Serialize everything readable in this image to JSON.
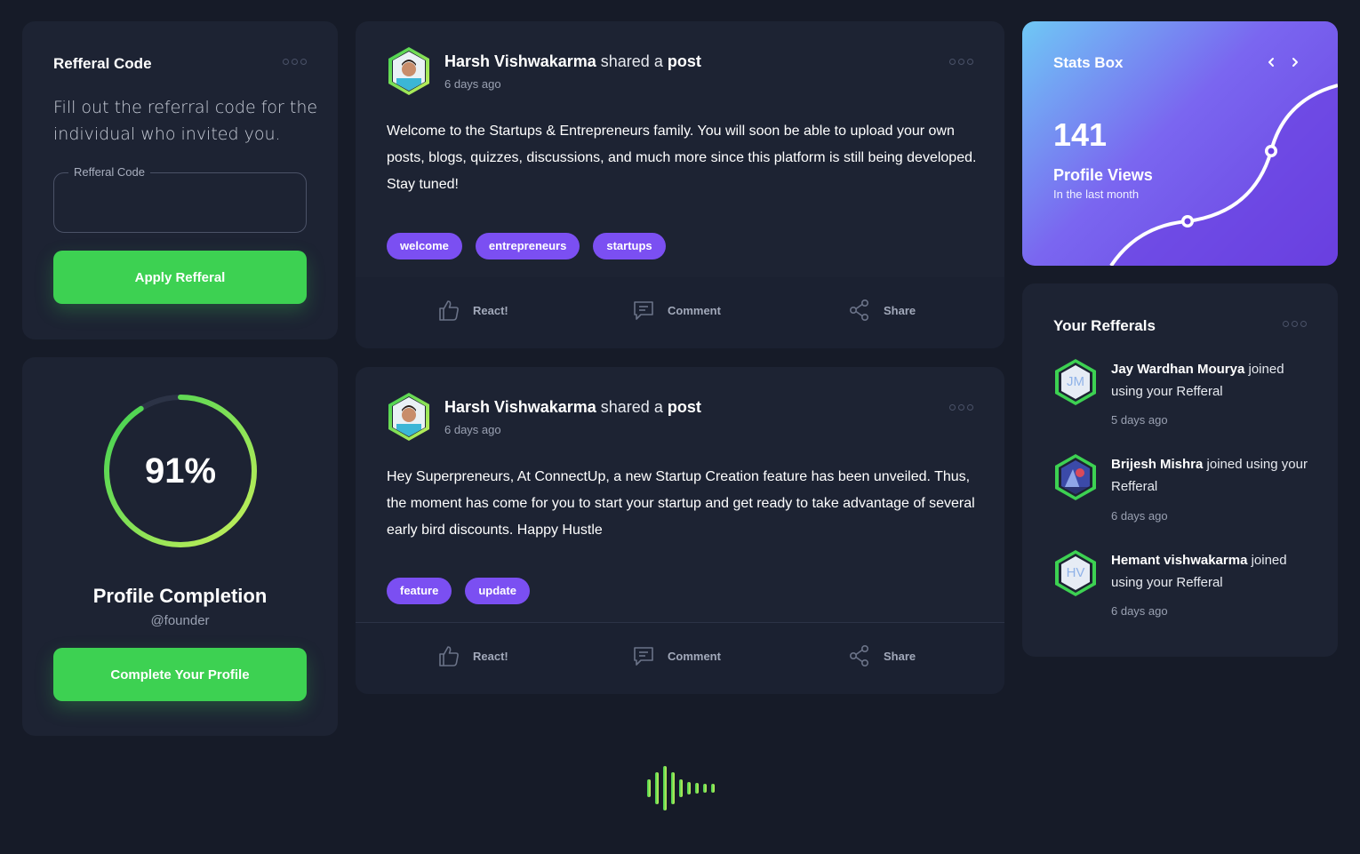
{
  "referral": {
    "title": "Refferal Code",
    "description": "Fill out the referral code for the individual who invited you.",
    "field_label": "Refferal Code",
    "field_value": "",
    "button": "Apply Refferal"
  },
  "profile": {
    "completion_percent": 91,
    "completion_text": "91%",
    "title": "Profile Completion",
    "handle": "@founder",
    "button": "Complete Your Profile"
  },
  "posts": [
    {
      "author": "Harsh Vishwakarma",
      "verb": "shared a",
      "object": "post",
      "time": "6 days ago",
      "body": "Welcome to the Startups & Entrepreneurs family. You will soon be able to upload your own posts, blogs, quizzes, discussions, and much more since this platform is still being developed. Stay tuned!",
      "tags": [
        "welcome",
        "entrepreneurs",
        "startups"
      ],
      "actions": {
        "react": "React!",
        "comment": "Comment",
        "share": "Share"
      }
    },
    {
      "author": "Harsh Vishwakarma",
      "verb": "shared a",
      "object": "post",
      "time": "6 days ago",
      "body": "Hey Superpreneurs, At ConnectUp, a new Startup Creation feature has been unveiled. Thus, the moment has come for you to start your startup and get ready to take advantage of several early bird discounts. Happy Hustle",
      "tags": [
        "feature",
        "update"
      ],
      "actions": {
        "react": "React!",
        "comment": "Comment",
        "share": "Share"
      }
    }
  ],
  "stats": {
    "title": "Stats Box",
    "value": "141",
    "label": "Profile Views",
    "sub": "In the last month"
  },
  "referrals": {
    "title": "Your Refferals",
    "items": [
      {
        "name": "Jay Wardhan Mourya",
        "text": "joined using your Refferal",
        "time": "5 days ago",
        "initials": "JM"
      },
      {
        "name": "Brijesh Mishra",
        "text": "joined using your Refferal",
        "time": "6 days ago",
        "initials": ""
      },
      {
        "name": "Hemant vishwakarma",
        "text": "joined using your Refferal",
        "time": "6 days ago",
        "initials": "HV"
      }
    ]
  },
  "colors": {
    "accent_green": "#3dd152",
    "tag_purple": "#7b4ff2",
    "card_bg": "#1d2333",
    "page_bg": "#161b28"
  },
  "icons": [
    "dots-menu-icon",
    "thumbs-up-icon",
    "comment-icon",
    "share-icon",
    "chevron-left-icon",
    "chevron-right-icon",
    "loader-bars-icon"
  ]
}
